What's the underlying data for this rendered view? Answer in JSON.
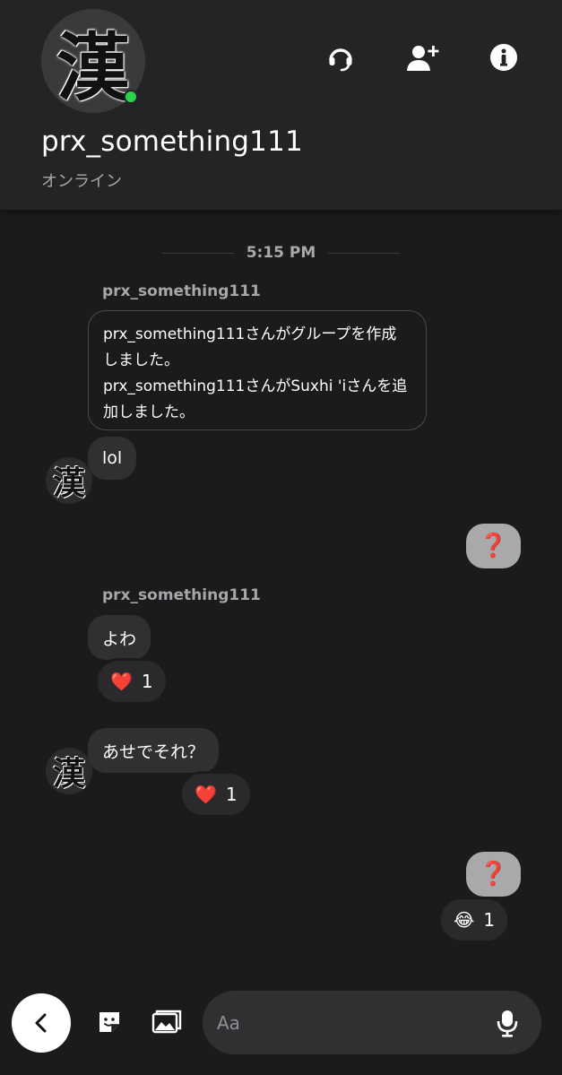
{
  "header": {
    "avatar_glyph": "漢",
    "username": "prx_something111",
    "status": "オンライン",
    "icons": [
      "headset-icon",
      "add-person-icon",
      "info-icon"
    ]
  },
  "chat": {
    "timestamp": "5:15 PM",
    "sender_1": "prx_something111",
    "system_lines": [
      "prx_something111さんがグループを作成しました。",
      "prx_something111さんがSuxhi 'iさんを追加しました。"
    ],
    "msg_lol": "lol",
    "mine_1": "❓",
    "sender_2": "prx_something111",
    "msg_yowa": "よわ",
    "reaction_1": {
      "emoji": "❤️",
      "count": "1"
    },
    "msg_asede": "あせでそれ？",
    "reaction_2": {
      "emoji": "❤️",
      "count": "1"
    },
    "mine_2": "❓",
    "reaction_3": {
      "emoji": "😂",
      "count": "1"
    },
    "avatar_glyph": "漢"
  },
  "composer": {
    "placeholder": "Aa",
    "icons": [
      "back-icon",
      "sticker-icon",
      "gallery-icon",
      "microphone-icon"
    ]
  },
  "colors": {
    "background": "#1b1b1d",
    "header": "#242426",
    "bubble": "#303033",
    "my_bubble": "#a9a9ab",
    "online": "#2bd24b"
  }
}
